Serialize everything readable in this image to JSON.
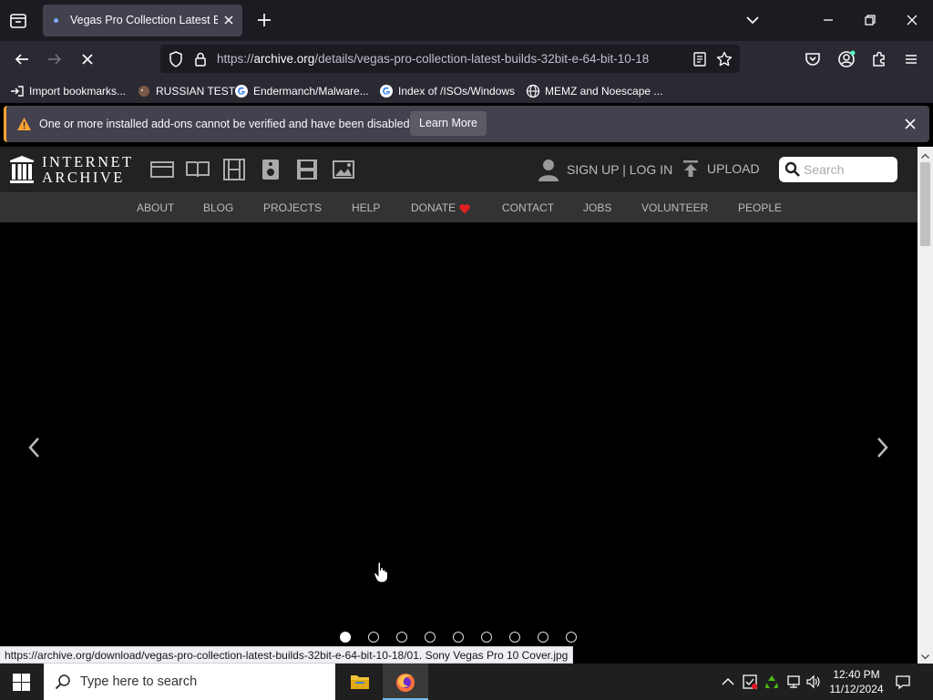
{
  "browser": {
    "tab": {
      "title": "Vegas Pro Collection Latest Buil"
    },
    "url": {
      "prefix": "https://",
      "domain": "archive.org",
      "path": "/details/vegas-pro-collection-latest-builds-32bit-e-64-bit-10-18"
    },
    "bookmarks": [
      "Import bookmarks...",
      "RUSSIAN TEST",
      "Endermanch/Malware...",
      "Index of /ISOs/Windows",
      "MEMZ and Noescape ..."
    ],
    "notification": {
      "message": "One or more installed add-ons cannot be verified and have been disabled.",
      "button": "Learn More"
    },
    "status_url": "https://archive.org/download/vegas-pro-collection-latest-builds-32bit-e-64-bit-10-18/01. Sony Vegas Pro 10 Cover.jpg"
  },
  "site": {
    "logo_line1": "INTERNET",
    "logo_line2": "ARCHIVE",
    "signup": "SIGN UP | LOG IN",
    "upload": "UPLOAD",
    "search_placeholder": "Search",
    "nav": [
      "ABOUT",
      "BLOG",
      "PROJECTS",
      "HELP",
      "DONATE",
      "CONTACT",
      "JOBS",
      "VOLUNTEER",
      "PEOPLE"
    ]
  },
  "taskbar": {
    "search_placeholder": "Type here to search",
    "time": "12:40 PM",
    "date": "11/12/2024"
  },
  "colors": {
    "accent": "#ffa436",
    "donate_heart": "#e02020",
    "taskbar_active": "#76b9ed"
  }
}
